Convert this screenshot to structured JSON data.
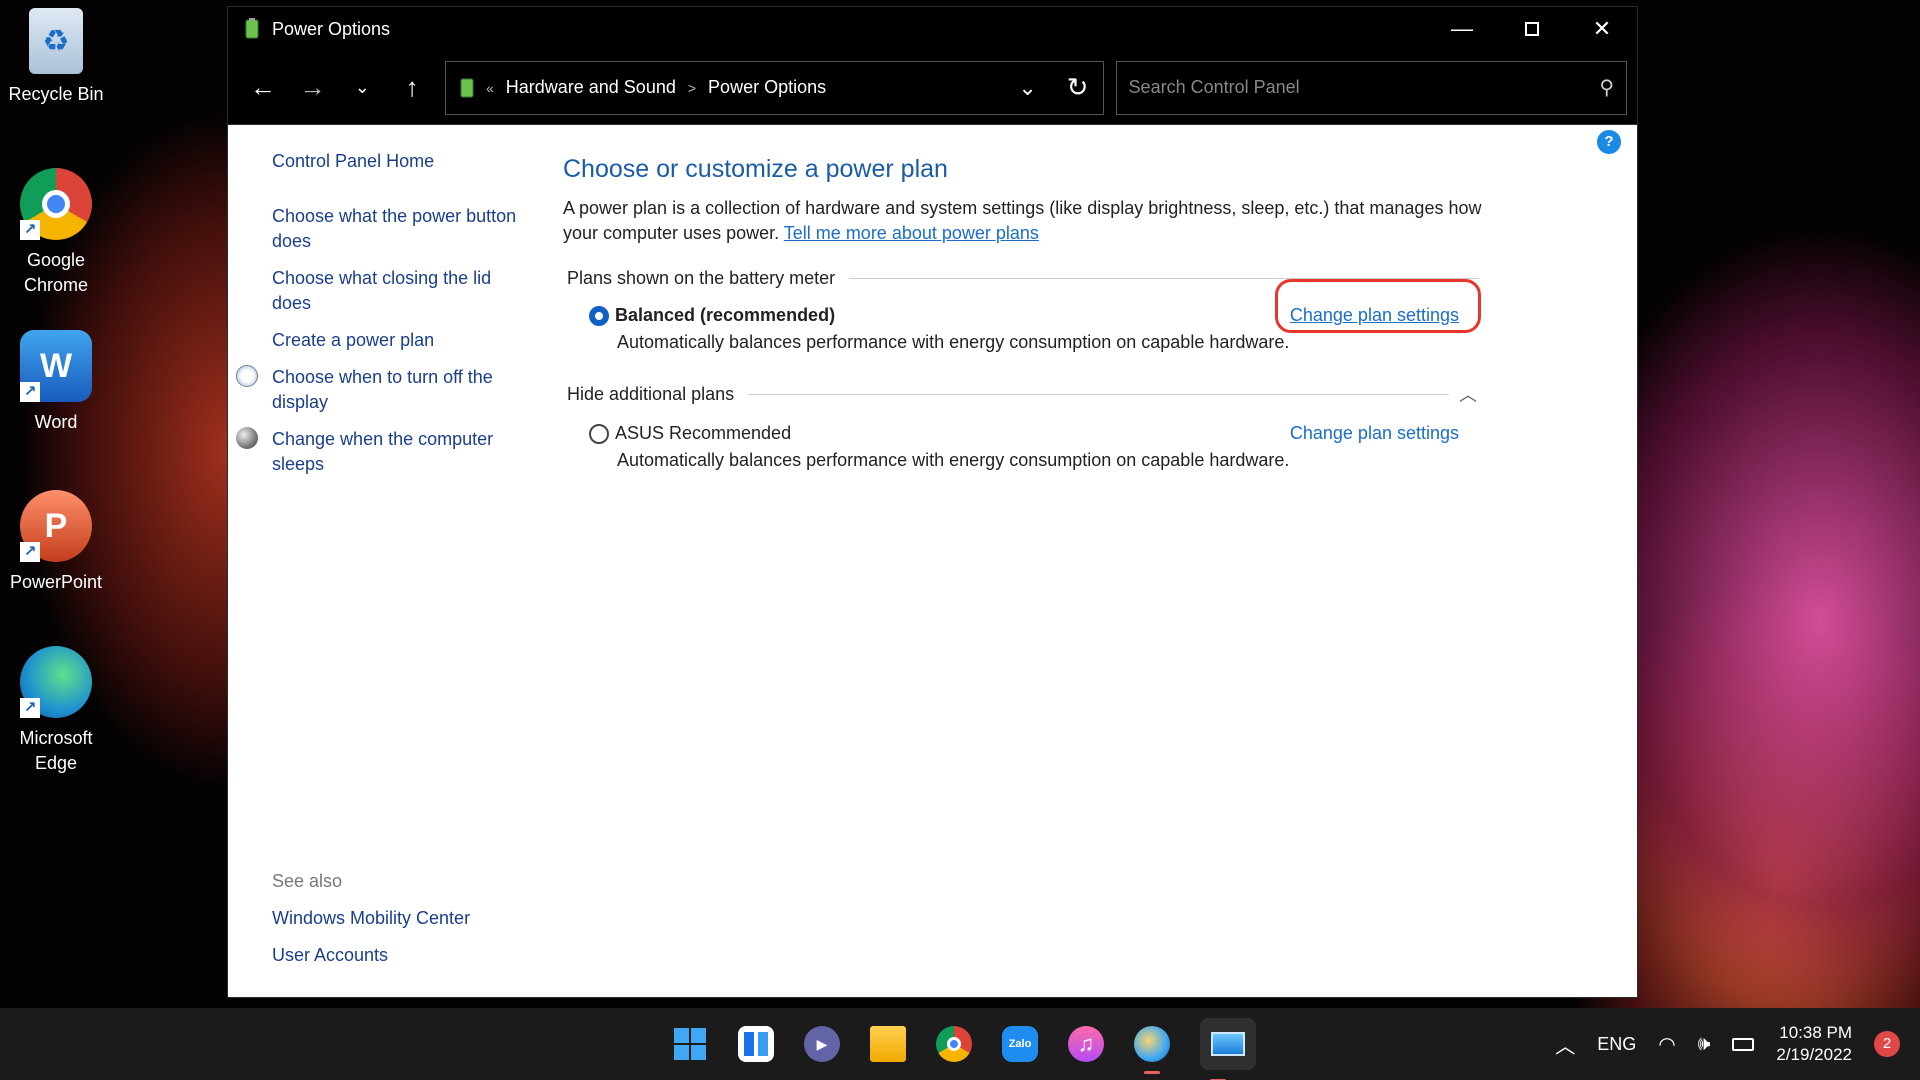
{
  "desktop": {
    "icons": [
      {
        "label": "Recycle Bin",
        "icon": "recycle-bin-icon"
      },
      {
        "label": "Google\nChrome",
        "icon": "chrome-icon"
      },
      {
        "label": "Word",
        "icon": "word-icon"
      },
      {
        "label": "PowerPoint",
        "icon": "powerpoint-icon"
      },
      {
        "label": "Microsoft\nEdge",
        "icon": "edge-icon"
      }
    ]
  },
  "window": {
    "title": "Power Options",
    "breadcrumb": {
      "overflow": "«",
      "parent": "Hardware and Sound",
      "separator": ">",
      "current": "Power Options"
    },
    "search_placeholder": "Search Control Panel"
  },
  "leftnav": {
    "home": "Control Panel Home",
    "items": [
      "Choose what the power button does",
      "Choose what closing the lid does",
      "Create a power plan",
      "Choose when to turn off the display",
      "Change when the computer sleeps"
    ],
    "see_also_label": "See also",
    "see_also": [
      "Windows Mobility Center",
      "User Accounts"
    ]
  },
  "main": {
    "heading": "Choose or customize a power plan",
    "description": "A power plan is a collection of hardware and system settings (like display brightness, sleep, etc.) that manages how your computer uses power.",
    "learn_more": "Tell me more about power plans",
    "battery_group": "Plans shown on the battery meter",
    "hidden_group": "Hide additional plans",
    "plans": [
      {
        "name": "Balanced (recommended)",
        "selected": true,
        "change_label": "Change plan settings",
        "description": "Automatically balances performance with energy consumption on capable hardware."
      },
      {
        "name": "ASUS Recommended",
        "selected": false,
        "change_label": "Change plan settings",
        "description": "Automatically balances performance with energy consumption on capable hardware."
      }
    ]
  },
  "taskbar": {
    "language": "ENG",
    "time": "10:38 PM",
    "date": "2/19/2022",
    "notifications": "2"
  },
  "colors": {
    "link": "#1a6ec9",
    "heading": "#1b5ca8",
    "highlight": "#e8362c"
  }
}
